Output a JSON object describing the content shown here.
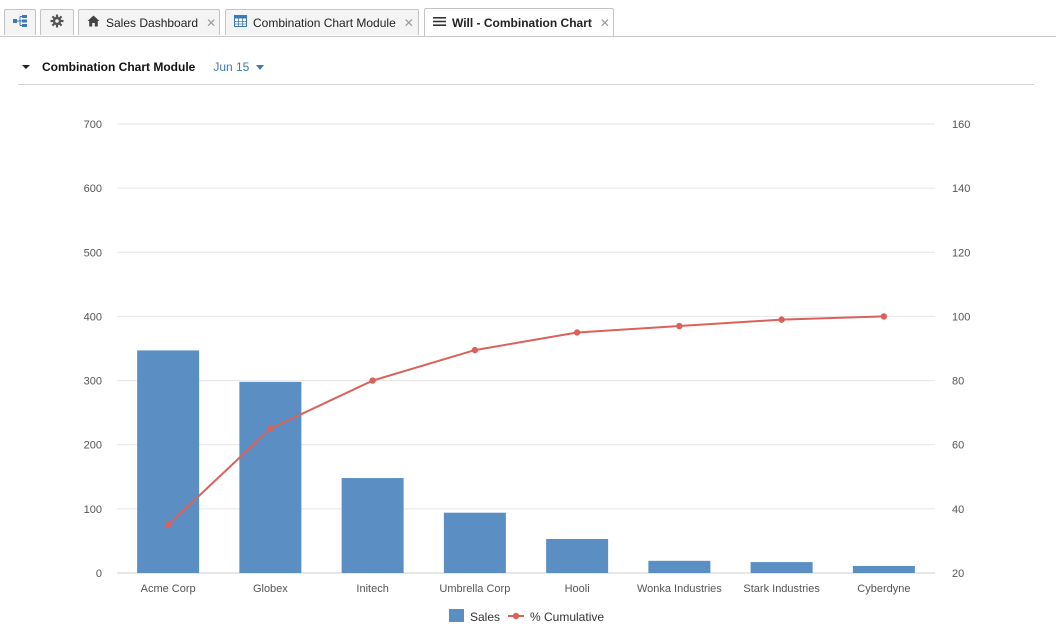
{
  "tabs": [
    {
      "icon": "hierarchy-icon",
      "label": ""
    },
    {
      "icon": "gear-icon",
      "label": ""
    },
    {
      "icon": "home-icon",
      "label": "Sales Dashboard"
    },
    {
      "icon": "table-icon",
      "label": "Combination Chart Module"
    },
    {
      "icon": "menu-icon",
      "label": "Will - Combination Chart",
      "active": true
    }
  ],
  "module": {
    "title": "Combination Chart Module",
    "period": "Jun 15"
  },
  "colors": {
    "bar": "#5b8fc4",
    "line": "#d9625a",
    "grid": "#e6e6e6",
    "accent": "#3c7ab6"
  },
  "chart_data": {
    "type": "bar",
    "categories": [
      "Acme Corp",
      "Globex",
      "Initech",
      "Umbrella Corp",
      "Hooli",
      "Wonka Industries",
      "Stark Industries",
      "Cyberdyne"
    ],
    "series": [
      {
        "name": "Sales",
        "type": "bar",
        "axis": "left",
        "values": [
          347,
          298,
          148,
          94,
          53,
          19,
          17,
          11
        ]
      },
      {
        "name": "% Cumulative",
        "type": "line",
        "axis": "right",
        "values": [
          35,
          65,
          80,
          89.5,
          95,
          97,
          99,
          100
        ]
      }
    ],
    "y_left": {
      "min": 0,
      "max": 700,
      "ticks": [
        0,
        100,
        200,
        300,
        400,
        500,
        600,
        700
      ]
    },
    "y_right": {
      "min": 20,
      "max": 160,
      "ticks": [
        20,
        40,
        60,
        80,
        100,
        120,
        140,
        160
      ]
    },
    "grid": true,
    "legend": "bottom-center"
  }
}
